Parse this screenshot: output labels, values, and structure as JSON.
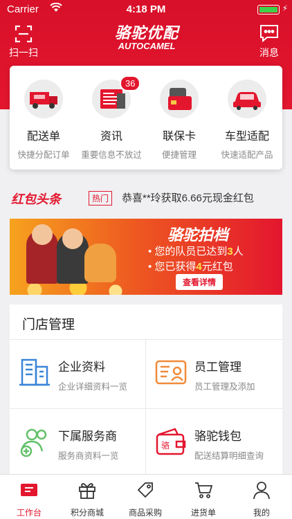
{
  "status_bar": {
    "carrier": "Carrier",
    "time": "4:18 PM"
  },
  "header": {
    "scan_label": "扫一扫",
    "logo_cn": "骆驼优配",
    "logo_en": "AUTOCAMEL",
    "message_label": "消息"
  },
  "features": [
    {
      "title": "配送单",
      "subtitle": "快捷分配订单",
      "icon": "delivery-truck-icon"
    },
    {
      "title": "资讯",
      "subtitle": "重要信息不放过",
      "icon": "news-icon",
      "badge": "36"
    },
    {
      "title": "联保卡",
      "subtitle": "便捷管理",
      "icon": "warranty-card-icon"
    },
    {
      "title": "车型适配",
      "subtitle": "快速适配产品",
      "icon": "car-icon"
    }
  ],
  "news_ticker": {
    "heading": "红包头条",
    "tag": "热门",
    "text": "恭喜**玲获取6.66元现金红包"
  },
  "banner": {
    "title": "骆驼拍档",
    "line1_prefix": "• 您的队员已达到",
    "line1_value": "3",
    "line1_suffix": "人",
    "line2_prefix": "• 您已获得",
    "line2_value": "4",
    "line2_suffix": "元红包",
    "button": "查看详情"
  },
  "store": {
    "title": "门店管理",
    "items": [
      {
        "title": "企业资料",
        "subtitle": "企业详细资料一览",
        "icon": "building-icon"
      },
      {
        "title": "员工管理",
        "subtitle": "员工管理及添加",
        "icon": "id-card-icon"
      },
      {
        "title": "下属服务商",
        "subtitle": "服务商资料一览",
        "icon": "add-user-icon"
      },
      {
        "title": "骆驼钱包",
        "subtitle": "配送结算明细查询",
        "icon": "wallet-icon"
      }
    ]
  },
  "tabs": [
    {
      "label": "工作台",
      "icon": "workbench-icon",
      "active": true
    },
    {
      "label": "积分商城",
      "icon": "gift-icon"
    },
    {
      "label": "商品采购",
      "icon": "tag-icon"
    },
    {
      "label": "进货单",
      "icon": "cart-icon"
    },
    {
      "label": "我的",
      "icon": "user-icon"
    }
  ],
  "colors": {
    "brand_red": "#e3162e",
    "blue": "#3a85d8",
    "orange": "#f08a3a",
    "green": "#62c06a"
  }
}
